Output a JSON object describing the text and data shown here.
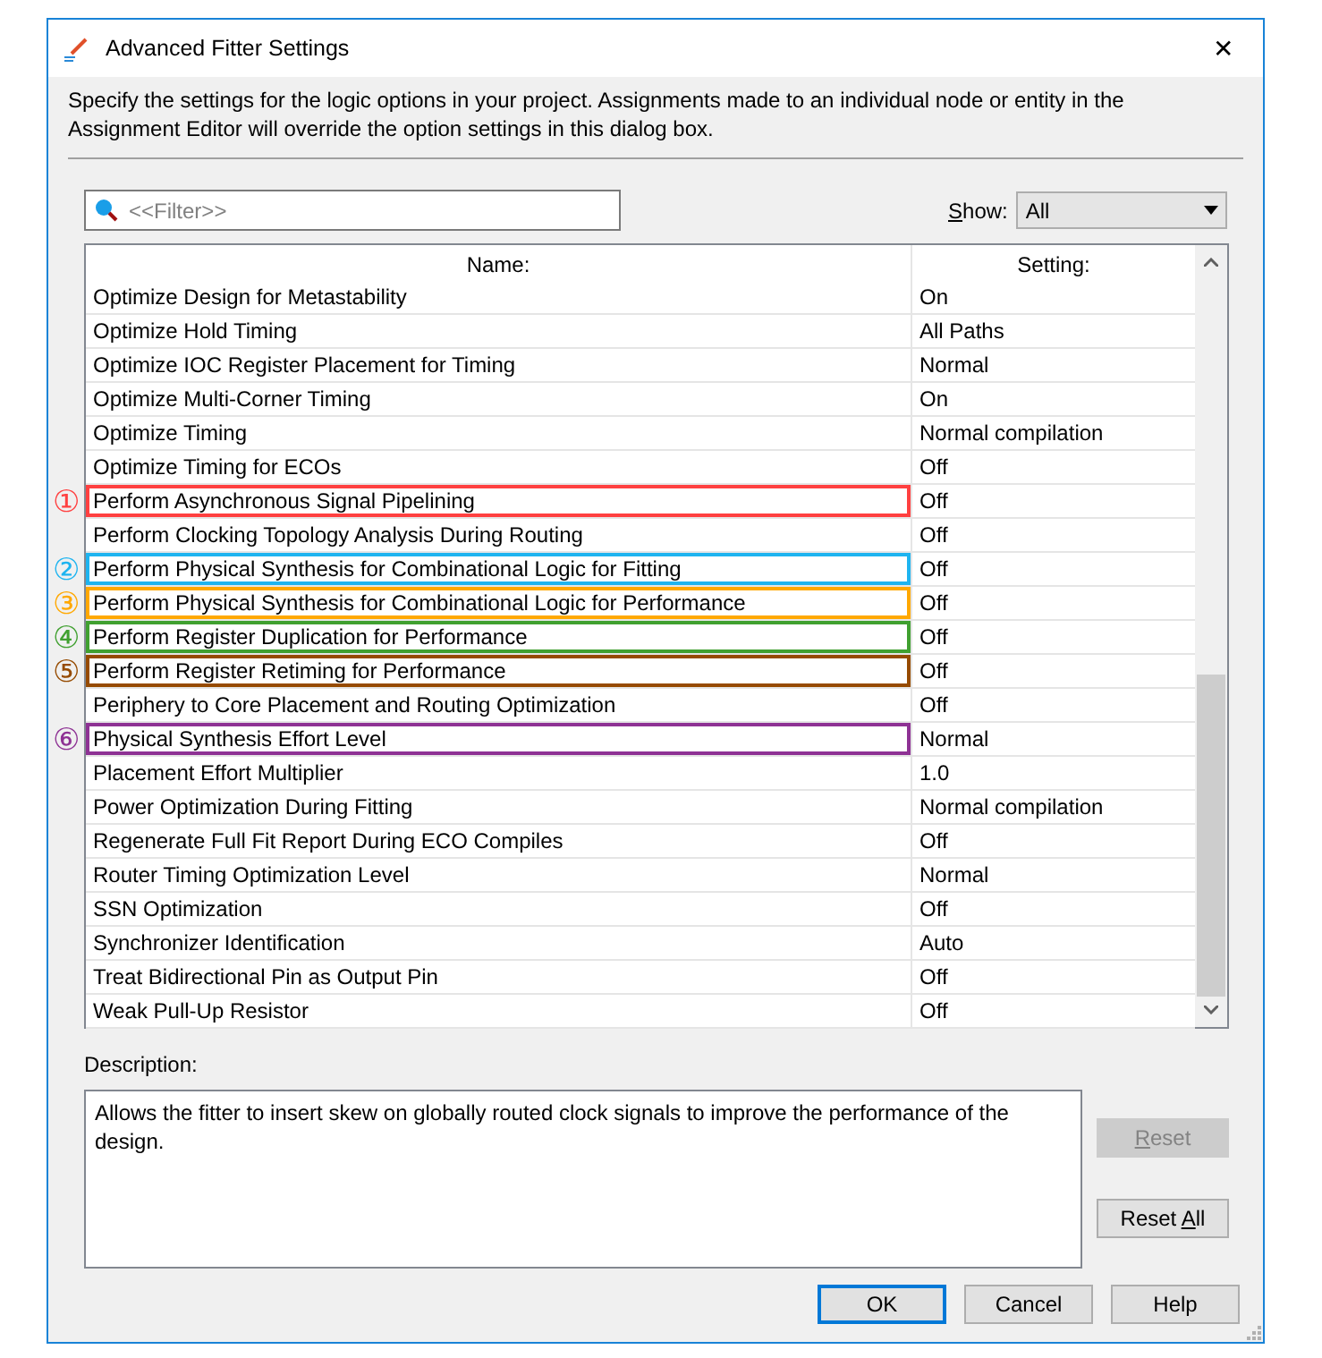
{
  "window": {
    "title": "Advanced Fitter Settings",
    "close": "✕"
  },
  "intro": "Specify the settings for the logic options in your project.  Assignments made to an individual node or entity in the Assignment Editor will override the option settings in this dialog box.",
  "filter": {
    "placeholder": "<<Filter>>"
  },
  "show": {
    "access_key": "S",
    "label_post": "how:",
    "value": "All"
  },
  "table": {
    "columns": [
      "Name:",
      "Setting:"
    ],
    "rows": [
      {
        "name": "Optimize Design for Metastability",
        "setting": "On"
      },
      {
        "name": "Optimize Hold Timing",
        "setting": "All Paths"
      },
      {
        "name": "Optimize IOC Register Placement for Timing",
        "setting": "Normal"
      },
      {
        "name": "Optimize Multi-Corner Timing",
        "setting": "On"
      },
      {
        "name": "Optimize Timing",
        "setting": "Normal compilation"
      },
      {
        "name": "Optimize Timing for ECOs",
        "setting": "Off"
      },
      {
        "name": "Perform Asynchronous Signal Pipelining",
        "setting": "Off",
        "marker": "①",
        "color": "#ff4040"
      },
      {
        "name": "Perform Clocking Topology Analysis During Routing",
        "setting": "Off"
      },
      {
        "name": "Perform Physical Synthesis for Combinational Logic for Fitting",
        "setting": "Off",
        "marker": "②",
        "color": "#1eb4f0"
      },
      {
        "name": "Perform Physical Synthesis for Combinational Logic for Performance",
        "setting": "Off",
        "marker": "③",
        "color": "#ffa800"
      },
      {
        "name": "Perform Register Duplication for Performance",
        "setting": "Off",
        "marker": "④",
        "color": "#40a030"
      },
      {
        "name": "Perform Register Retiming for Performance",
        "setting": "Off",
        "marker": "⑤",
        "color": "#964b00"
      },
      {
        "name": "Periphery to Core Placement and Routing Optimization",
        "setting": "Off"
      },
      {
        "name": "Physical Synthesis Effort Level",
        "setting": "Normal",
        "marker": "⑥",
        "color": "#8e3294"
      },
      {
        "name": "Placement Effort Multiplier",
        "setting": "1.0"
      },
      {
        "name": "Power Optimization During Fitting",
        "setting": "Normal compilation"
      },
      {
        "name": "Regenerate Full Fit Report During ECO Compiles",
        "setting": "Off"
      },
      {
        "name": "Router Timing Optimization Level",
        "setting": "Normal"
      },
      {
        "name": "SSN Optimization",
        "setting": "Off"
      },
      {
        "name": "Synchronizer Identification",
        "setting": "Auto"
      },
      {
        "name": "Treat Bidirectional Pin as Output Pin",
        "setting": "Off"
      },
      {
        "name": "Weak Pull-Up Resistor",
        "setting": "Off"
      }
    ]
  },
  "description": {
    "label": "Description:",
    "text": "Allows the fitter to insert skew on globally routed clock signals to improve the performance of the design."
  },
  "side_buttons": [
    {
      "access_key": "R",
      "label_post": "eset",
      "disabled": true
    },
    {
      "label_pre": "Reset ",
      "access_key": "A",
      "label_post": "ll",
      "disabled": false
    }
  ],
  "buttons": [
    {
      "label": "OK",
      "default": true
    },
    {
      "label": "Cancel",
      "default": false
    },
    {
      "label": "Help",
      "default": false
    }
  ]
}
